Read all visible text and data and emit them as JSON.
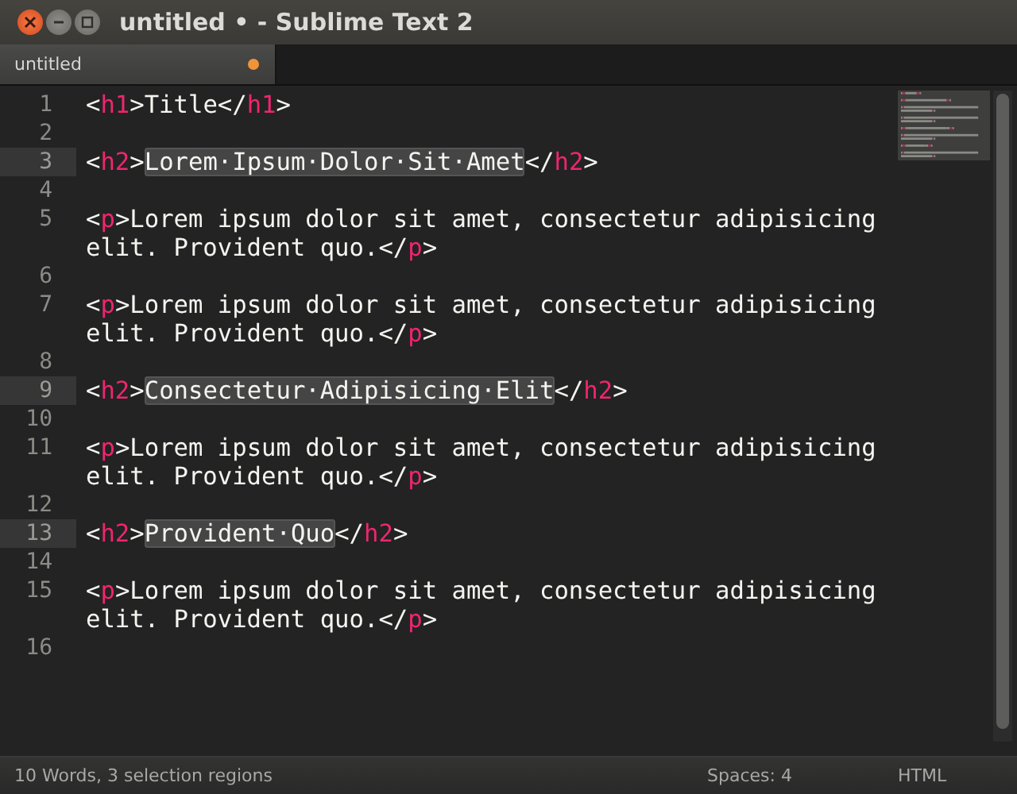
{
  "window": {
    "title": "untitled • - Sublime Text 2"
  },
  "tabs": [
    {
      "label": "untitled",
      "selected": true,
      "modified": true
    }
  ],
  "editor": {
    "lines": [
      {
        "number": "1",
        "current": false,
        "rows": [
          {
            "spans": [
              {
                "kind": "plain",
                "text": "<"
              },
              {
                "kind": "tag",
                "text": "h1"
              },
              {
                "kind": "plain",
                "text": ">Title</"
              },
              {
                "kind": "tag",
                "text": "h1"
              },
              {
                "kind": "plain",
                "text": ">"
              }
            ]
          }
        ]
      },
      {
        "number": "2",
        "current": false,
        "rows": [
          {}
        ]
      },
      {
        "number": "3",
        "current": true,
        "rows": [
          {
            "spans": [
              {
                "kind": "plain",
                "text": "<"
              },
              {
                "kind": "tag",
                "text": "h2"
              },
              {
                "kind": "plain",
                "text": ">"
              },
              {
                "kind": "selection",
                "text": "Lorem·Ipsum·Dolor·Sit·Amet"
              },
              {
                "kind": "plain",
                "text": "</"
              },
              {
                "kind": "tag",
                "text": "h2"
              },
              {
                "kind": "plain",
                "text": ">"
              }
            ]
          }
        ]
      },
      {
        "number": "4",
        "current": false,
        "rows": [
          {}
        ]
      },
      {
        "number": "5",
        "current": false,
        "rows": [
          {
            "spans": [
              {
                "kind": "plain",
                "text": "<"
              },
              {
                "kind": "tag",
                "text": "p"
              },
              {
                "kind": "plain",
                "text": ">Lorem ipsum dolor sit amet, consectetur adipisicing"
              }
            ]
          },
          {
            "spans": [
              {
                "kind": "plain",
                "text": "elit. Provident quo.</"
              },
              {
                "kind": "tag",
                "text": "p"
              },
              {
                "kind": "plain",
                "text": ">"
              }
            ]
          }
        ]
      },
      {
        "number": "6",
        "current": false,
        "rows": [
          {}
        ]
      },
      {
        "number": "7",
        "current": false,
        "rows": [
          {
            "spans": [
              {
                "kind": "plain",
                "text": "<"
              },
              {
                "kind": "tag",
                "text": "p"
              },
              {
                "kind": "plain",
                "text": ">Lorem ipsum dolor sit amet, consectetur adipisicing"
              }
            ]
          },
          {
            "spans": [
              {
                "kind": "plain",
                "text": "elit. Provident quo.</"
              },
              {
                "kind": "tag",
                "text": "p"
              },
              {
                "kind": "plain",
                "text": ">"
              }
            ]
          }
        ]
      },
      {
        "number": "8",
        "current": false,
        "rows": [
          {}
        ]
      },
      {
        "number": "9",
        "current": true,
        "rows": [
          {
            "spans": [
              {
                "kind": "plain",
                "text": "<"
              },
              {
                "kind": "tag",
                "text": "h2"
              },
              {
                "kind": "plain",
                "text": ">"
              },
              {
                "kind": "selection",
                "text": "Consectetur·Adipisicing·Elit"
              },
              {
                "kind": "plain",
                "text": "</"
              },
              {
                "kind": "tag",
                "text": "h2"
              },
              {
                "kind": "plain",
                "text": ">"
              }
            ]
          }
        ]
      },
      {
        "number": "10",
        "current": false,
        "rows": [
          {}
        ]
      },
      {
        "number": "11",
        "current": false,
        "rows": [
          {
            "spans": [
              {
                "kind": "plain",
                "text": "<"
              },
              {
                "kind": "tag",
                "text": "p"
              },
              {
                "kind": "plain",
                "text": ">Lorem ipsum dolor sit amet, consectetur adipisicing"
              }
            ]
          },
          {
            "spans": [
              {
                "kind": "plain",
                "text": "elit. Provident quo.</"
              },
              {
                "kind": "tag",
                "text": "p"
              },
              {
                "kind": "plain",
                "text": ">"
              }
            ]
          }
        ]
      },
      {
        "number": "12",
        "current": false,
        "rows": [
          {}
        ]
      },
      {
        "number": "13",
        "current": true,
        "rows": [
          {
            "spans": [
              {
                "kind": "plain",
                "text": "<"
              },
              {
                "kind": "tag",
                "text": "h2"
              },
              {
                "kind": "plain",
                "text": ">"
              },
              {
                "kind": "selection",
                "text": "Provident·Quo"
              },
              {
                "kind": "plain",
                "text": "</"
              },
              {
                "kind": "tag",
                "text": "h2"
              },
              {
                "kind": "plain",
                "text": ">"
              }
            ]
          }
        ]
      },
      {
        "number": "14",
        "current": false,
        "rows": [
          {}
        ]
      },
      {
        "number": "15",
        "current": false,
        "rows": [
          {
            "spans": [
              {
                "kind": "plain",
                "text": "<"
              },
              {
                "kind": "tag",
                "text": "p"
              },
              {
                "kind": "plain",
                "text": ">Lorem ipsum dolor sit amet, consectetur adipisicing"
              }
            ]
          },
          {
            "spans": [
              {
                "kind": "plain",
                "text": "elit. Provident quo.</"
              },
              {
                "kind": "tag",
                "text": "p"
              },
              {
                "kind": "plain",
                "text": ">"
              }
            ]
          }
        ]
      },
      {
        "number": "16",
        "current": false,
        "rows": [
          {}
        ]
      }
    ]
  },
  "status_bar": {
    "message": "10 Words, 3 selection regions",
    "indentation": "Spaces: 4",
    "syntax": "HTML"
  }
}
